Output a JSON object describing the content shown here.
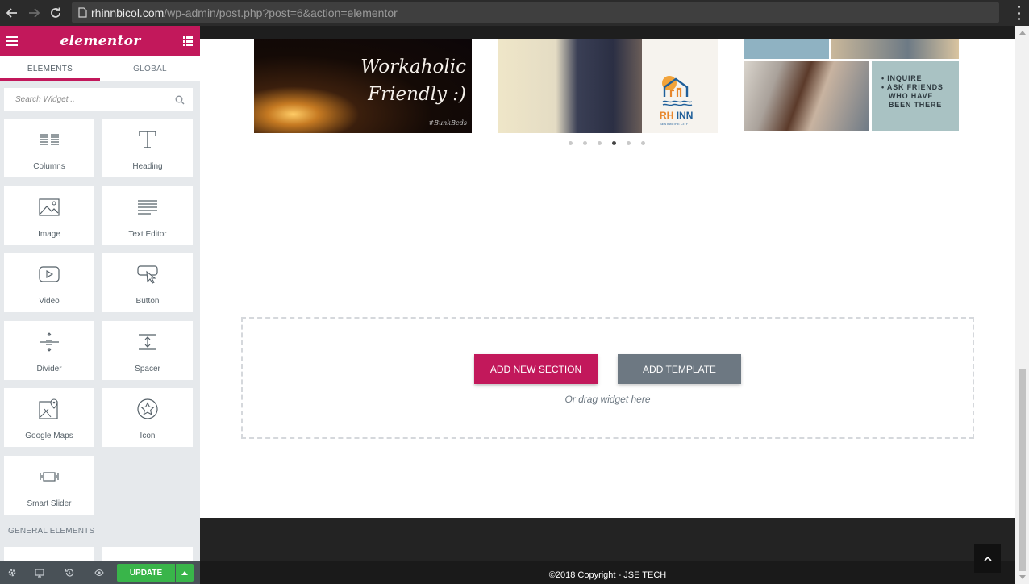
{
  "browser": {
    "url_host": "rhinnbicol.com",
    "url_path": "/wp-admin/post.php?post=6&action=elementor"
  },
  "panel": {
    "logo": "elementor",
    "tabs": [
      {
        "label": "ELEMENTS",
        "active": true
      },
      {
        "label": "GLOBAL",
        "active": false
      }
    ],
    "search": {
      "placeholder": "Search Widget...",
      "value": ""
    },
    "widgets": [
      {
        "label": "Columns",
        "icon": "columns-icon"
      },
      {
        "label": "Heading",
        "icon": "heading-icon"
      },
      {
        "label": "Image",
        "icon": "image-icon"
      },
      {
        "label": "Text Editor",
        "icon": "text-editor-icon"
      },
      {
        "label": "Video",
        "icon": "video-icon"
      },
      {
        "label": "Button",
        "icon": "button-icon"
      },
      {
        "label": "Divider",
        "icon": "divider-icon"
      },
      {
        "label": "Spacer",
        "icon": "spacer-icon"
      },
      {
        "label": "Google Maps",
        "icon": "google-maps-icon"
      },
      {
        "label": "Icon",
        "icon": "star-icon"
      },
      {
        "label": "Smart Slider",
        "icon": "smart-slider-icon"
      }
    ],
    "section_label": "GENERAL ELEMENTS",
    "footer": {
      "update_label": "UPDATE",
      "icons": [
        "settings-icon",
        "responsive-icon",
        "history-icon",
        "preview-eye-icon"
      ]
    },
    "accent_color": "#c2185b"
  },
  "preview": {
    "slides": [
      {
        "title_line1": "Workaholic",
        "title_line2": "Friendly :)",
        "tag": "#BunkBeds"
      },
      {
        "brand_a": "RH",
        "brand_b": "INN",
        "tagline": "SEA INN THE CITY"
      },
      {
        "lines": [
          "• INQUIRE",
          "• ASK FRIENDS",
          "WHO HAVE",
          "BEEN THERE"
        ]
      }
    ],
    "carousel": {
      "dot_count": 6,
      "active_index": 3
    },
    "drop_zone": {
      "add_section_label": "ADD NEW SECTION",
      "add_template_label": "ADD TEMPLATE",
      "drag_hint": "Or drag widget here"
    },
    "footer": {
      "copyright": "©2018 Copyright - JSE TECH"
    }
  }
}
